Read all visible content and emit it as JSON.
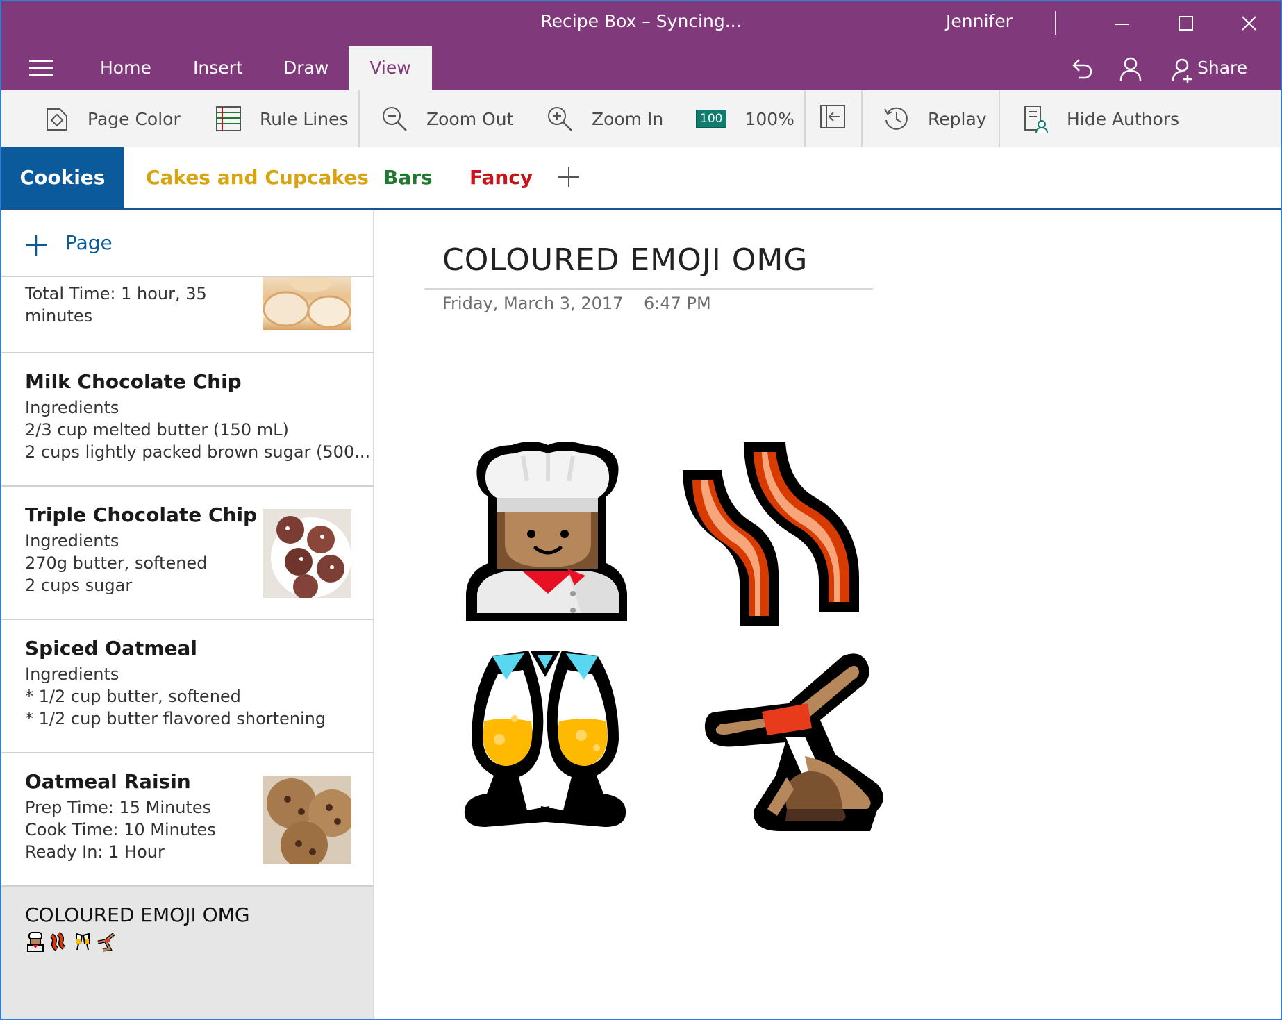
{
  "window": {
    "title": "Recipe Box – Syncing...",
    "user": "Jennifer"
  },
  "ribbon": {
    "tabs": [
      "Home",
      "Insert",
      "Draw",
      "View"
    ],
    "active_tab": "View",
    "share_label": "Share"
  },
  "toolbar": {
    "page_color": "Page Color",
    "rule_lines": "Rule Lines",
    "zoom_out": "Zoom Out",
    "zoom_in": "Zoom In",
    "zoom_badge": "100",
    "zoom_level": "100%",
    "replay": "Replay",
    "hide_authors": "Hide Authors"
  },
  "sections": [
    {
      "label": "Cookies",
      "color": "#ffffff"
    },
    {
      "label": "Cakes and Cupcakes",
      "color": "#d9a412"
    },
    {
      "label": "Bars",
      "color": "#1f7a2f"
    },
    {
      "label": "Fancy",
      "color": "#c4161c"
    }
  ],
  "pagelist": {
    "add_label": "Page",
    "items": [
      {
        "title": "",
        "lines": [
          "Total Time: 1 hour, 35",
          "minutes"
        ]
      },
      {
        "title": "Milk Chocolate Chip",
        "lines": [
          "Ingredients",
          "2/3 cup melted butter (150 mL)",
          "2 cups lightly packed brown sugar (500..."
        ]
      },
      {
        "title": "Triple Chocolate Chip",
        "lines": [
          "Ingredients",
          "270g butter, softened",
          "2 cups sugar"
        ]
      },
      {
        "title": "Spiced Oatmeal",
        "lines": [
          "Ingredients",
          "* 1/2 cup butter, softened",
          "* 1/2 cup butter flavored shortening"
        ]
      },
      {
        "title": "Oatmeal Raisin",
        "lines": [
          "Prep Time: 15 Minutes",
          "Cook Time: 10 Minutes",
          "Ready In: 1 Hour"
        ]
      },
      {
        "title": "COLOURED EMOJI OMG",
        "lines": []
      }
    ]
  },
  "page": {
    "title": "COLOURED EMOJI OMG",
    "date": "Friday, March 3, 2017",
    "time": "6:47 PM"
  },
  "colors": {
    "titlebar": "#80397b",
    "section_active": "#0b5a9c",
    "accent_blue": "#0b5a9c"
  }
}
